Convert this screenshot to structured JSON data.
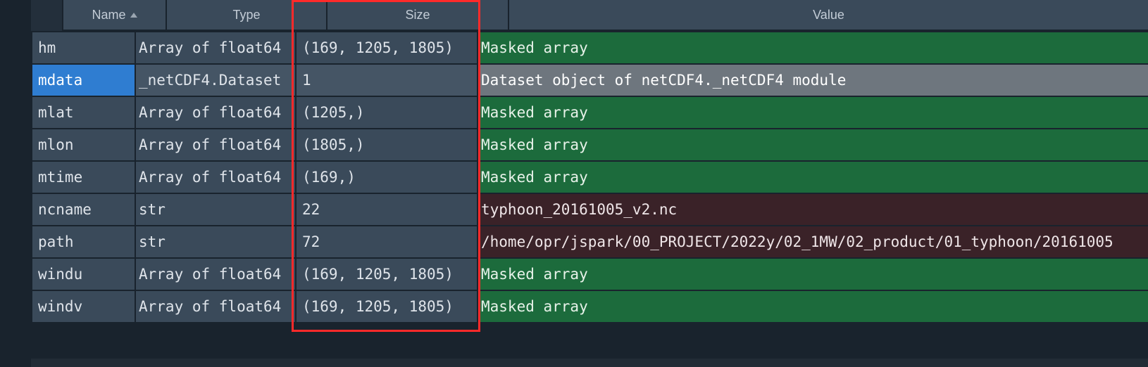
{
  "headers": {
    "name": "Name",
    "type": "Type",
    "size": "Size",
    "value": "Value"
  },
  "rows": [
    {
      "name": "hm",
      "type": "Array of float64",
      "size": "(169, 1205, 1805)",
      "value": "Masked array",
      "kind": "array",
      "selected": false
    },
    {
      "name": "mdata",
      "type": "_netCDF4.Dataset",
      "size": "1",
      "value": "Dataset object of netCDF4._netCDF4 module",
      "kind": "obj",
      "selected": true
    },
    {
      "name": "mlat",
      "type": "Array of float64",
      "size": "(1205,)",
      "value": "Masked array",
      "kind": "array",
      "selected": false
    },
    {
      "name": "mlon",
      "type": "Array of float64",
      "size": "(1805,)",
      "value": "Masked array",
      "kind": "array",
      "selected": false
    },
    {
      "name": "mtime",
      "type": "Array of float64",
      "size": "(169,)",
      "value": "Masked array",
      "kind": "array",
      "selected": false
    },
    {
      "name": "ncname",
      "type": "str",
      "size": "22",
      "value": "typhoon_20161005_v2.nc",
      "kind": "str",
      "selected": false
    },
    {
      "name": "path",
      "type": "str",
      "size": "72",
      "value": "/home/opr/jspark/00_PROJECT/2022y/02_1MW/02_product/01_typhoon/20161005",
      "kind": "str",
      "selected": false
    },
    {
      "name": "windu",
      "type": "Array of float64",
      "size": "(169, 1205, 1805)",
      "value": "Masked array",
      "kind": "array",
      "selected": false
    },
    {
      "name": "windv",
      "type": "Array of float64",
      "size": "(169, 1205, 1805)",
      "value": "Masked array",
      "kind": "array",
      "selected": false
    }
  ]
}
